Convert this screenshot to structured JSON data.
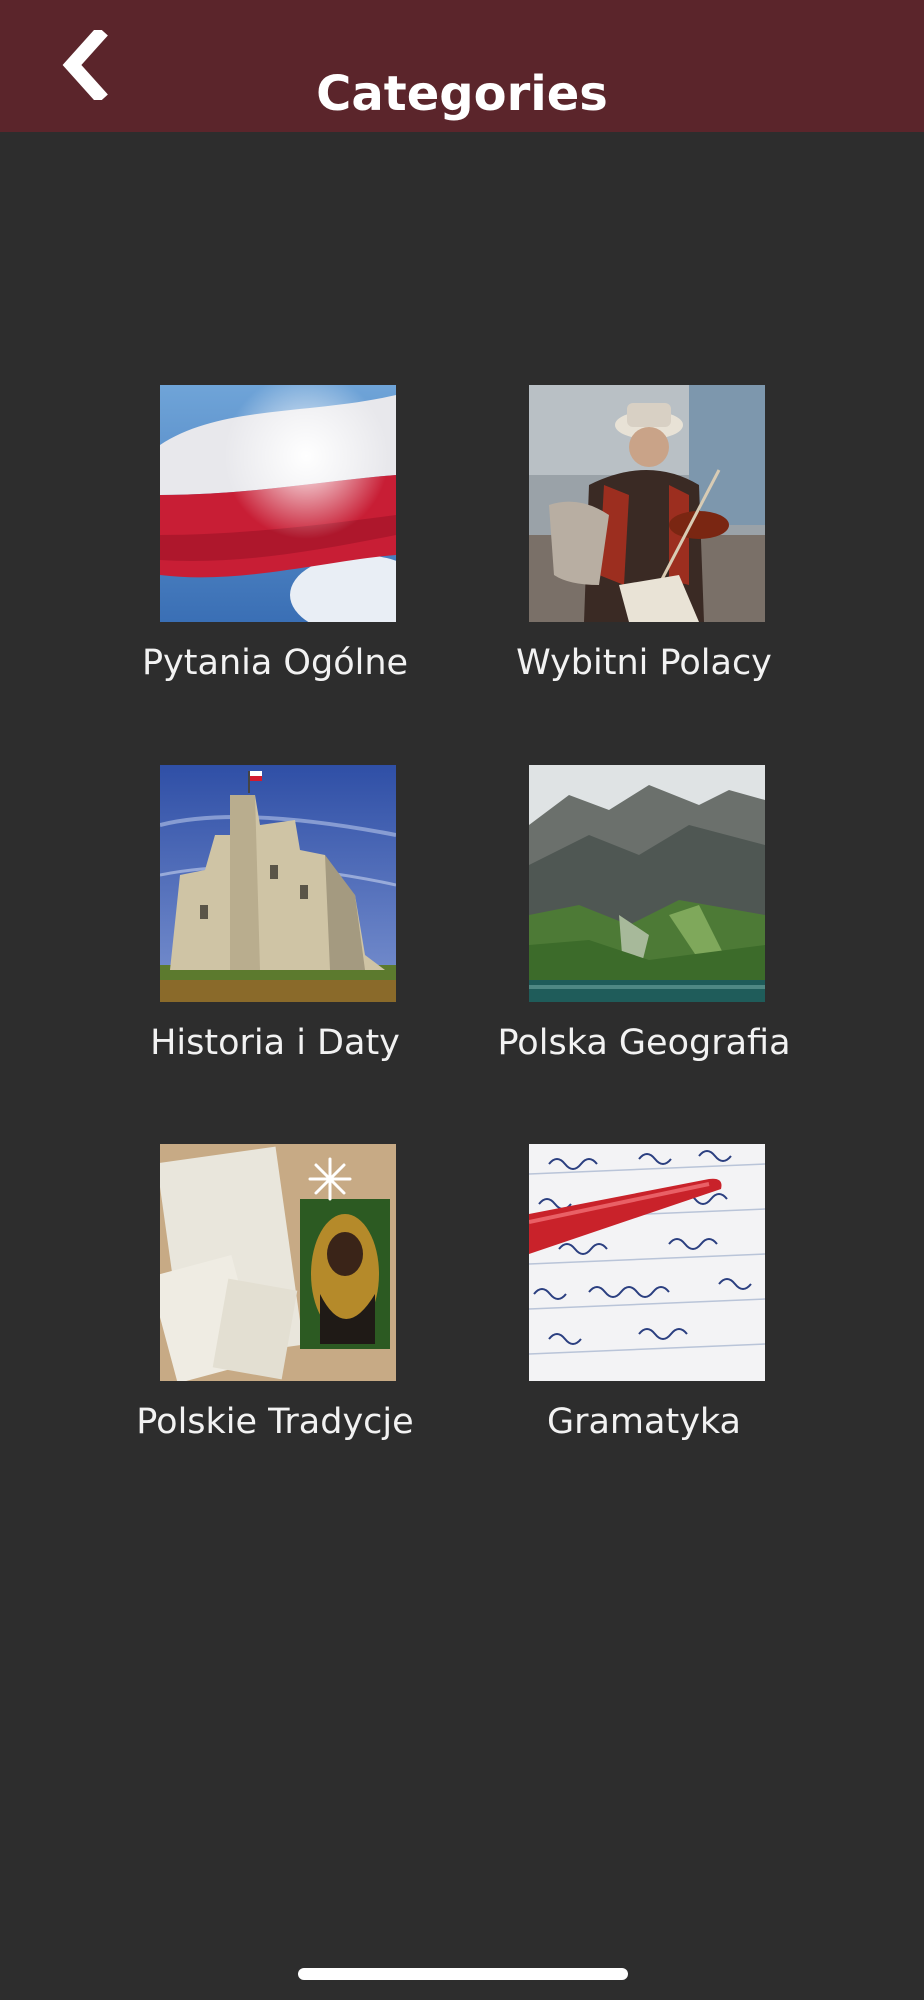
{
  "header": {
    "title": "Categories",
    "back_icon": "chevron-left-icon",
    "background": "#5b252b"
  },
  "categories": [
    {
      "label": "Pytania Ogólne",
      "image": "polish-flag-image"
    },
    {
      "label": "Wybitni Polacy",
      "image": "violinist-image"
    },
    {
      "label": "Historia i Daty",
      "image": "castle-image"
    },
    {
      "label": "Polska Geografia",
      "image": "mountains-lake-image"
    },
    {
      "label": "Polskie Tradycje",
      "image": "christmas-wafer-image"
    },
    {
      "label": "Gramatyka",
      "image": "handwriting-pen-image"
    }
  ],
  "colors": {
    "background": "#2d2d2d",
    "text": "#f2f2f2"
  }
}
